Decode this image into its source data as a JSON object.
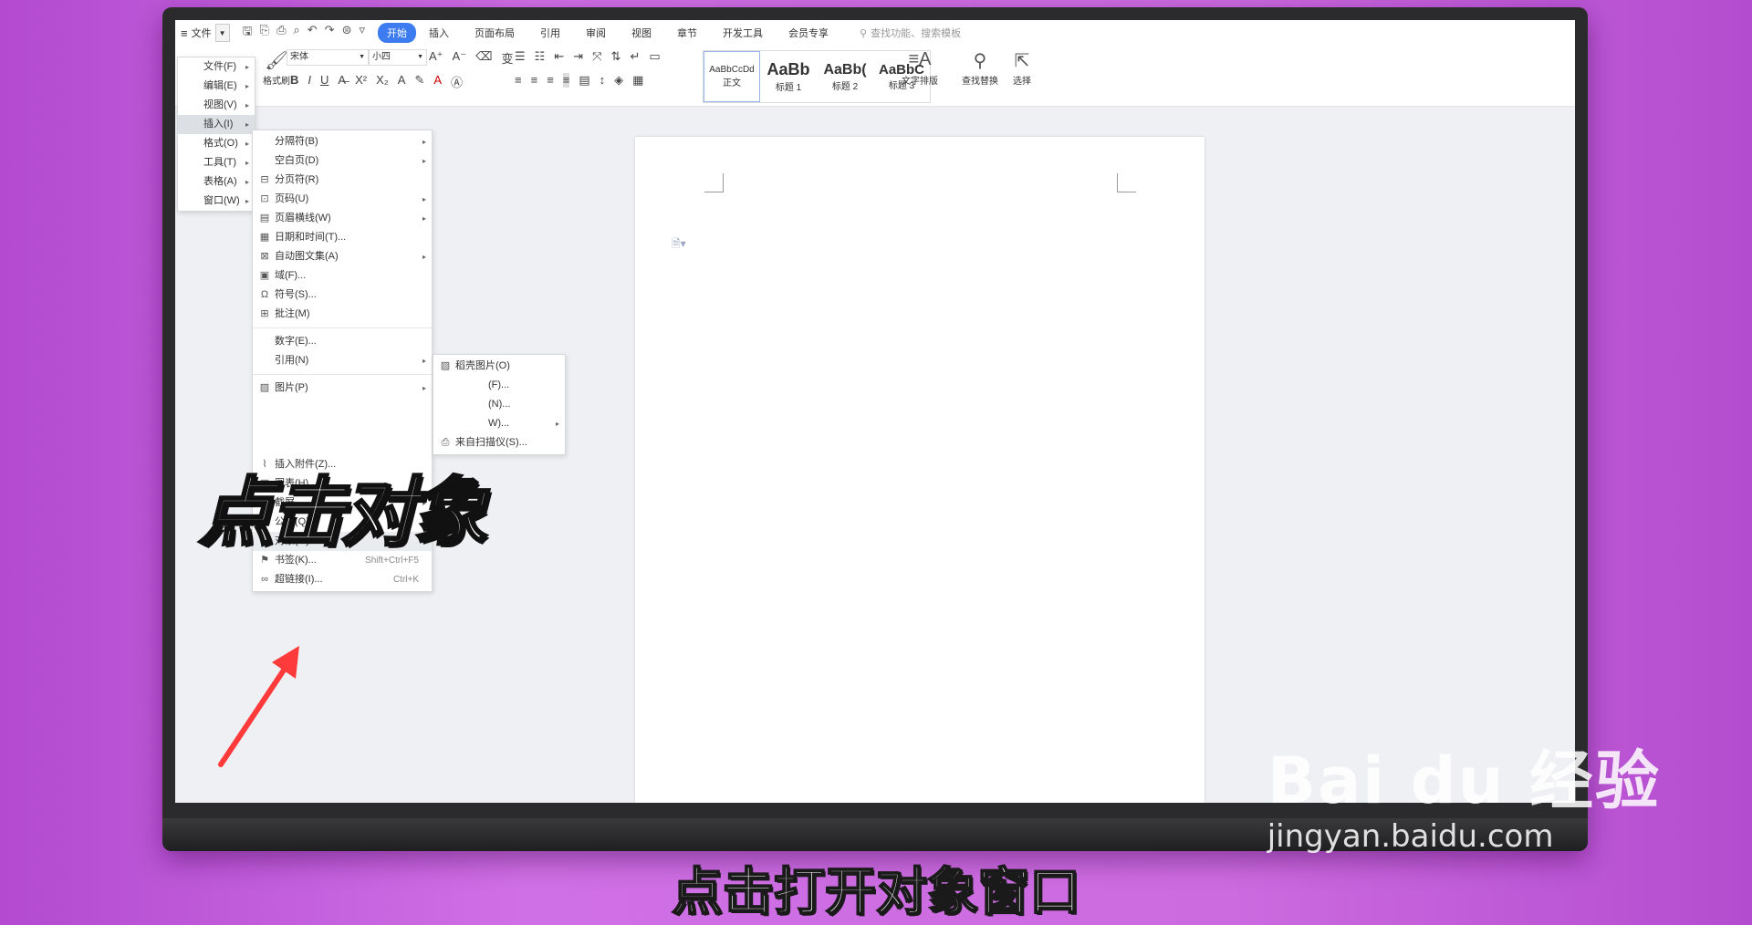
{
  "topbar": {
    "file_menu": "文件",
    "tabs": [
      "开始",
      "插入",
      "页面布局",
      "引用",
      "审阅",
      "视图",
      "章节",
      "开发工具",
      "会员专享"
    ],
    "search_placeholder": "查找功能、搜索模板"
  },
  "ribbon": {
    "format_painter": "格式刷",
    "font_name": "宋体",
    "font_size": "小四",
    "styles": [
      {
        "preview": "AaBbCcDd",
        "label": "正文"
      },
      {
        "preview": "AaBb",
        "label": "标题 1"
      },
      {
        "preview": "AaBb(",
        "label": "标题 2"
      },
      {
        "preview": "AaBbC",
        "label": "标题 3"
      }
    ],
    "text_layout": "文字排版",
    "find_replace": "查找替换",
    "select": "选择"
  },
  "left_menu": [
    {
      "label": "文件(F)"
    },
    {
      "label": "编辑(E)"
    },
    {
      "label": "视图(V)"
    },
    {
      "label": "插入(I)"
    },
    {
      "label": "格式(O)"
    },
    {
      "label": "工具(T)"
    },
    {
      "label": "表格(A)"
    },
    {
      "label": "窗口(W)"
    }
  ],
  "insert_menu": [
    {
      "label": "分隔符(B)"
    },
    {
      "label": "空白页(D)"
    },
    {
      "label": "分页符(R)"
    },
    {
      "label": "页码(U)"
    },
    {
      "label": "页眉横线(W)"
    },
    {
      "label": "日期和时间(T)..."
    },
    {
      "label": "自动图文集(A)"
    },
    {
      "label": "域(F)..."
    },
    {
      "label": "符号(S)..."
    },
    {
      "label": "批注(M)"
    },
    {
      "label": "数字(E)..."
    },
    {
      "label": "引用(N)"
    },
    {
      "label": "图片(P)"
    },
    {
      "label": "插入附件(Z)..."
    },
    {
      "label": "图表(H)..."
    },
    {
      "label": "截屏"
    },
    {
      "label": "公式(Q)..."
    },
    {
      "label": "对象(O)..."
    },
    {
      "label": "书签(K)...",
      "shortcut": "Shift+Ctrl+F5"
    },
    {
      "label": "超链接(I)...",
      "shortcut": "Ctrl+K"
    }
  ],
  "picture_submenu": [
    {
      "label": "稻壳图片(O)"
    },
    {
      "label": "(F)..."
    },
    {
      "label": "(N)..."
    },
    {
      "label": "W)..."
    },
    {
      "label": "来自扫描仪(S)..."
    }
  ],
  "overlay_text": "点击对象",
  "caption": "点击打开对象窗口",
  "watermark": {
    "brand": "Bai du 经验",
    "url": "jingyan.baidu.com"
  }
}
